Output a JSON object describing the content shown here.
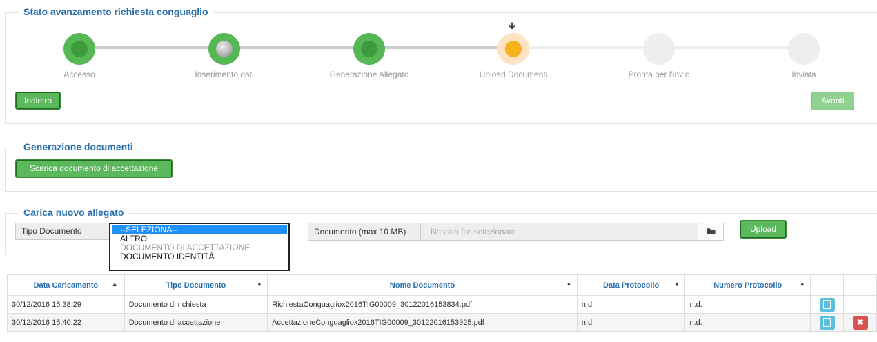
{
  "progress": {
    "legend": "Stato avanzamento richiesta conguaglio",
    "current_marker": "🡻",
    "steps": [
      {
        "label": "Accesso",
        "state": "done"
      },
      {
        "label": "Inserimento dati",
        "state": "done"
      },
      {
        "label": "Generazione Allegato",
        "state": "done"
      },
      {
        "label": "Upload Documenti",
        "state": "current"
      },
      {
        "label": "Pronta per l'invio",
        "state": "todo"
      },
      {
        "label": "Inviata",
        "state": "todo"
      }
    ],
    "back_label": "Indietro",
    "next_label": "Avanti"
  },
  "generation": {
    "legend": "Generazione documenti",
    "download_label": "Scarica documento di accettazione"
  },
  "upload": {
    "legend": "Carica nuovo allegato",
    "type_label": "Tipo Documento",
    "type_options": [
      "--SELEZIONA--",
      "ALTRO",
      "DOCUMENTO DI ACCETTAZIONE",
      "DOCUMENTO IDENTITÀ"
    ],
    "file_label": "Documento (max 10 MB)",
    "file_placeholder": "Nessun file selezionato",
    "upload_label": "Upload"
  },
  "table": {
    "headers": [
      "Data Caricamento",
      "Tipo Documento",
      "Nome Documento",
      "Data Protocollo",
      "Numero Protocollo"
    ],
    "rows": [
      [
        "30/12/2016 15:38:29",
        "Documento di richiesta",
        "RichiestaConguagliox2016TIG00009_30122016153834.pdf",
        "n.d.",
        "n.d."
      ],
      [
        "30/12/2016 15:40:22",
        "Documento di accettazione",
        "AccettazioneConguagliox2016TIG00009_30122016153925.pdf",
        "n.d.",
        "n.d."
      ]
    ]
  },
  "colors": {
    "accent": "#2a6fb0",
    "done": "#55b855",
    "current": "#f6b21a",
    "todo": "#eeeeee"
  }
}
